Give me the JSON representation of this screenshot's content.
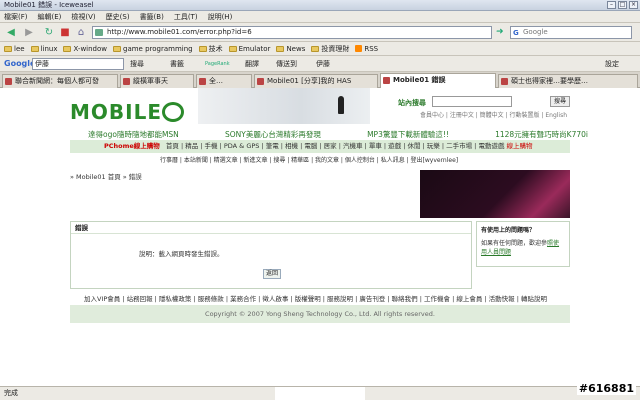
{
  "window": {
    "title": "Mobile01 錯誤 - Iceweasel"
  },
  "menu": [
    "檔案(F)",
    "編輯(E)",
    "檢視(V)",
    "歷史(S)",
    "書籤(B)",
    "工具(T)",
    "說明(H)"
  ],
  "nav": {
    "url": "http://www.mobile01.com/error.php?id=6",
    "search_placeholder": "Google"
  },
  "bookmarks": [
    "lee",
    "linux",
    "X-window",
    "game programming",
    "技术",
    "Emulator",
    "News",
    "投資理財",
    "RSS"
  ],
  "google_toolbar": {
    "logo": "Google",
    "input": "伊藤",
    "search": "搜尋",
    "bookmarks": "書籤",
    "pagerank": "PageRank",
    "translate": "翻譯",
    "autolink": "傳送到",
    "spell": "伊藤",
    "settings": "設定"
  },
  "tabs": [
    "聯合新聞網：每個人都可發",
    "縱橫軍事天",
    "全…",
    "Mobile01 [分享]我的 HAS",
    "Mobile01 錯誤",
    "碩士也得家裡…要學歷…"
  ],
  "page": {
    "logo": "MOBILE",
    "site_search_label": "站內搜尋",
    "site_search_button": "搜尋",
    "top_links": "會員中心 | 注冊中文 | 簡體中文 | 行動裝置版 | English",
    "promo": [
      "達得ogo隨時隨地都能MSN",
      "SONY美麗心台灣精彩再發現",
      "MP3驚豐下載新體驗這!!",
      "1128元擁有聲巧時尚K770i"
    ],
    "catbar_pchome": "PChome線上購物",
    "catbar": "首頁 | 精品 | 手機 | PDA & GPS | 筆電 | 相機 | 電腦 | 居家 | 汽機車 | 單車 | 遊戲 | 休閒 | 玩樂 | 二手市場 | 電動遊戲",
    "catbar_red": "線上購物",
    "subnav": "行事曆 | 本站新聞 | 精選文章 | 新進文章 | 搜尋 | 精華區 | 我的文章 | 個人控制台 | 私人訊息 | 登出[wyvernlee]",
    "breadcrumb": "» Mobile01 首頁 » 錯誤",
    "error_title": "錯誤",
    "error_message": "說明：載入網頁時發生錯誤。",
    "back_button": "返回",
    "help_title": "有使用上的問題嗎？",
    "help_text": "如果有任何問題，歡迎參",
    "help_link": "照使用人員問題",
    "footer_nav": "加入VIP會員 | 站務回報 | 隱私權政策 | 服務條款 | 業務合作 | 徵人啟事 | 版權聲明 | 服務說明 | 廣告刊登 | 聯絡我們 | 工作機會 | 線上會員 | 活動快報 | 轉貼說明",
    "copyright": "Copyright © 2007 Yong Sheng Technology Co., Ltd. All rights reserved."
  },
  "status": {
    "text": "完成"
  },
  "watermark": "#616881"
}
